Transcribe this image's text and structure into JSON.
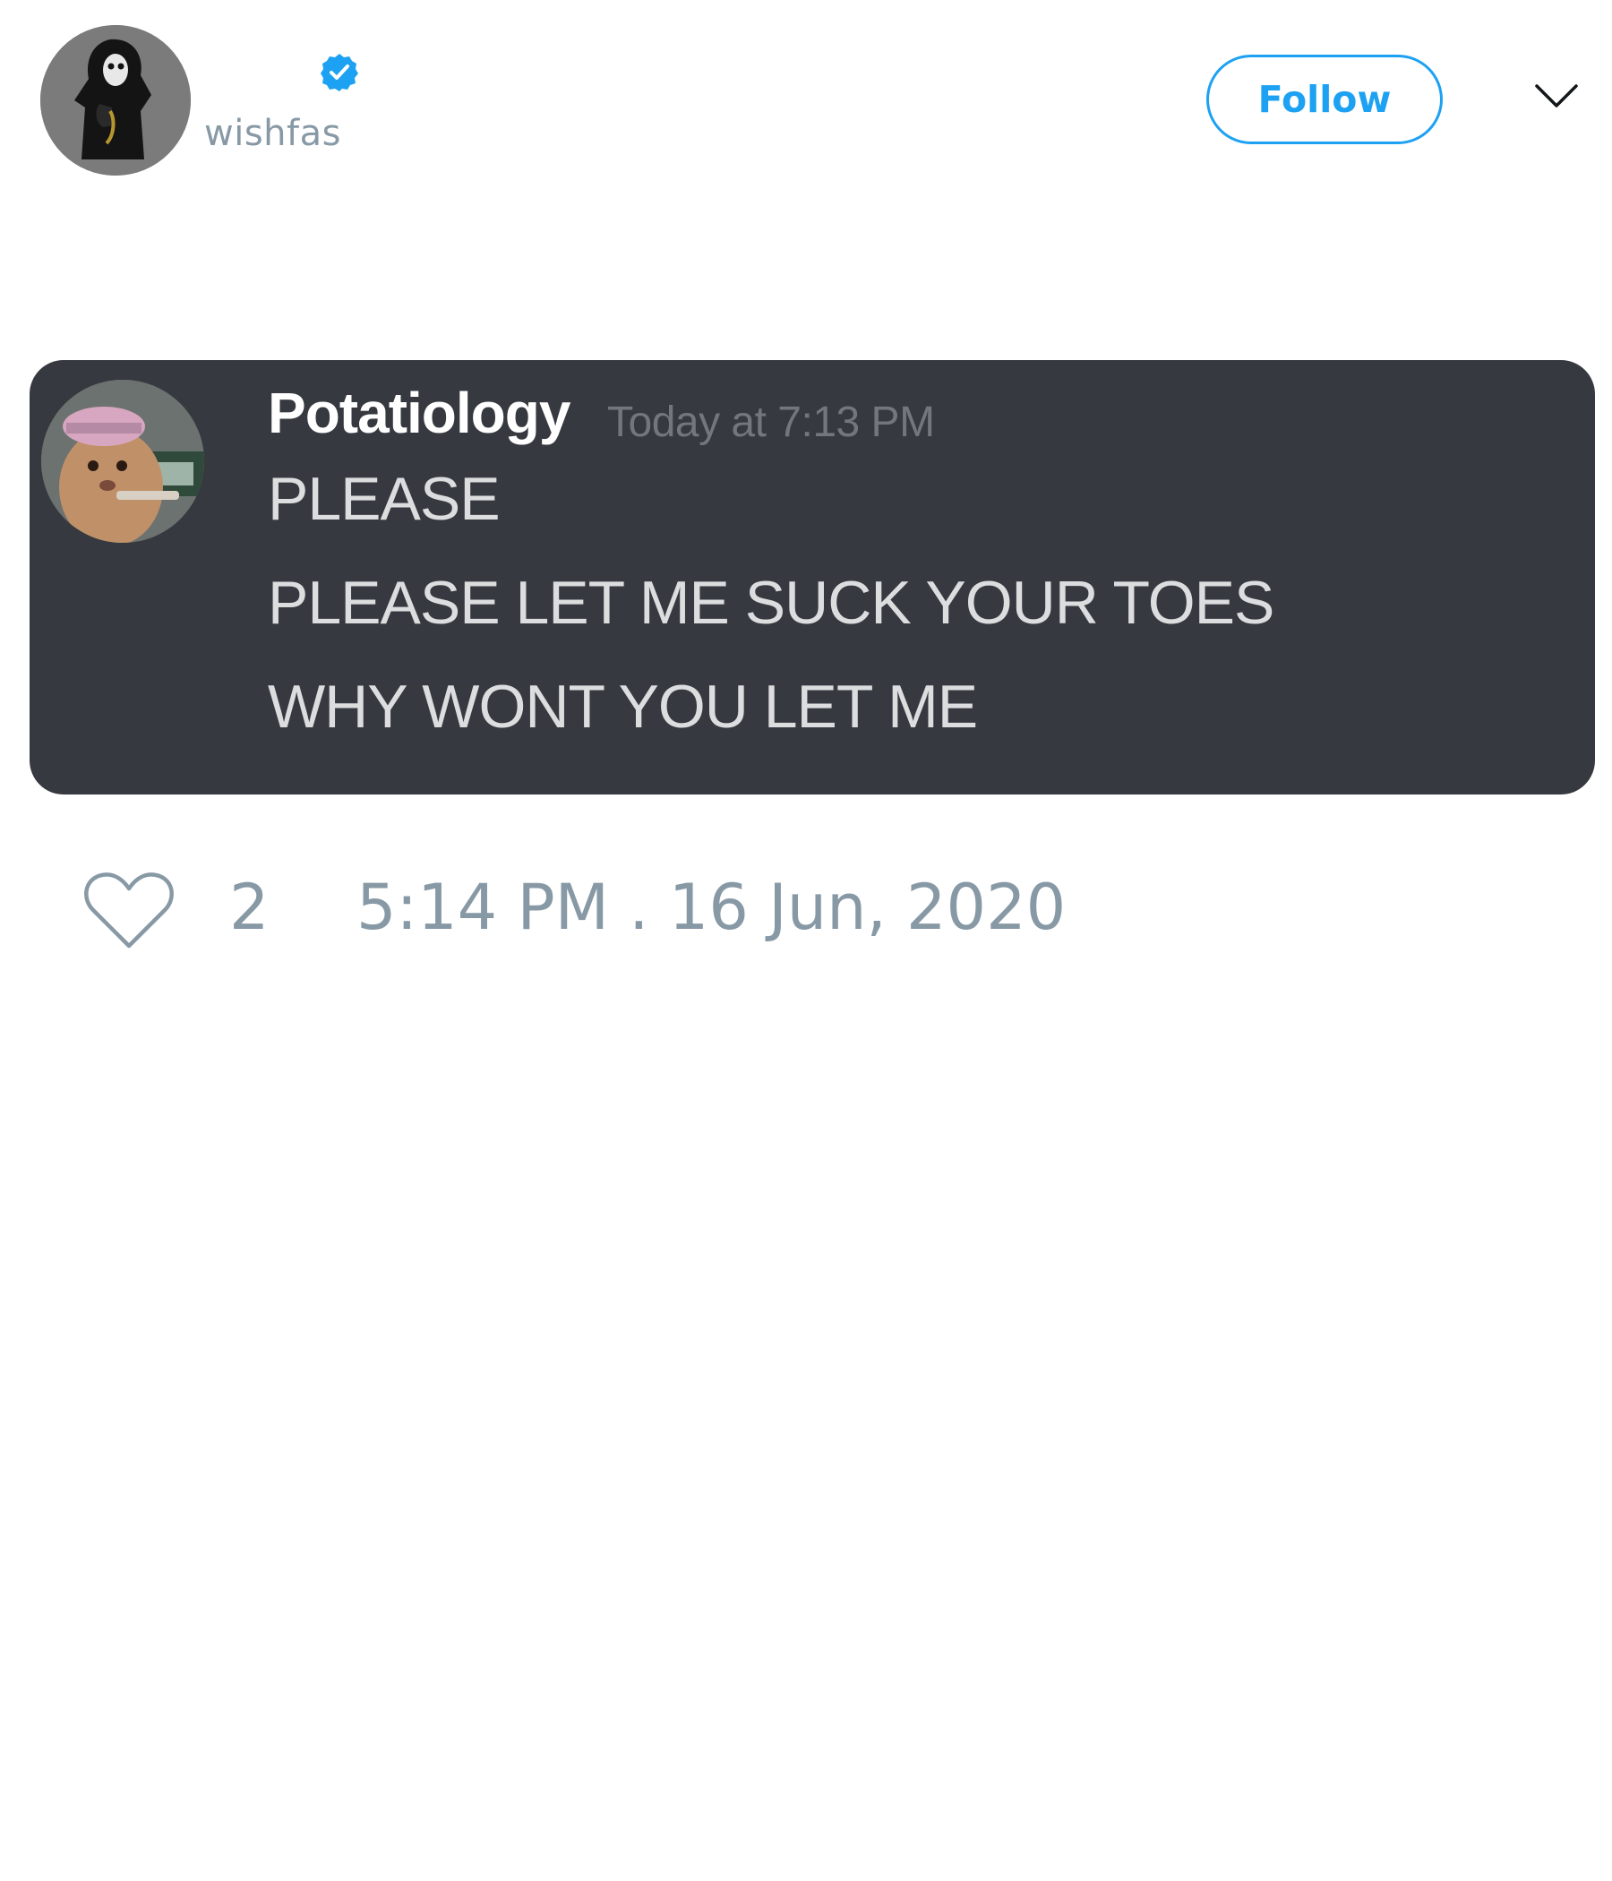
{
  "author": {
    "display_name": "",
    "handle": "wishfas",
    "verified": true,
    "avatar_icon": "masked-figure-avatar"
  },
  "header": {
    "follow_label": "Follow",
    "menu_icon": "chevron-down-icon"
  },
  "embed": {
    "avatar_icon": "hamster-avatar",
    "username": "Potatiology",
    "timestamp": "Today at 7:13 PM",
    "lines": [
      "PLEASE",
      "PLEASE LET ME SUCK YOUR TOES",
      "WHY WONT YOU LET ME"
    ]
  },
  "footer": {
    "like_icon": "heart-icon",
    "like_count": "2",
    "time": "5:14 PM . 16 Jun, 2020"
  },
  "colors": {
    "accent": "#1da1f2",
    "muted_text": "#8899a6",
    "embed_background": "#36393f",
    "embed_text": "#dcddde",
    "embed_timestamp": "#72767d"
  }
}
